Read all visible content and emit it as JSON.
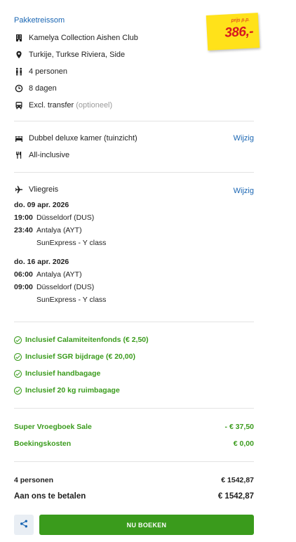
{
  "header": {
    "title": "Pakketreissom"
  },
  "price": {
    "per_person_label": "prijs p.p.",
    "amount": "386,-"
  },
  "package": {
    "hotel": "Kamelya Collection Aishen Club",
    "location": "Turkije, Turkse Riviera, Side",
    "persons": "4 personen",
    "duration": "8 dagen",
    "transfer": "Excl. transfer",
    "transfer_note": "(optioneel)"
  },
  "room": {
    "type": "Dubbel deluxe kamer (tuinzicht)",
    "board": "All-inclusive",
    "edit_label": "Wijzig"
  },
  "flight": {
    "title": "Vliegreis",
    "edit_label": "Wijzig",
    "legs": [
      {
        "date": "do. 09 apr. 2026",
        "dep_time": "19:00",
        "dep_airport": "Düsseldorf (DUS)",
        "arr_time": "23:40",
        "arr_airport": "Antalya (AYT)",
        "carrier": "SunExpress - Y class"
      },
      {
        "date": "do. 16 apr. 2026",
        "dep_time": "06:00",
        "dep_airport": "Antalya (AYT)",
        "arr_time": "09:00",
        "arr_airport": "Düsseldorf (DUS)",
        "carrier": "SunExpress - Y class"
      }
    ]
  },
  "inclusions": [
    "Inclusief Calamiteitenfonds (€ 2,50)",
    "Inclusief SGR bijdrage (€ 20,00)",
    "Inclusief handbagage",
    "Inclusief 20 kg ruimbagage"
  ],
  "discounts": [
    {
      "label": "Super Vroegboek Sale",
      "value": "- € 37,50"
    },
    {
      "label": "Boekingskosten",
      "value": "€ 0,00"
    }
  ],
  "totals": {
    "persons_label": "4 personen",
    "persons_value": "€ 1542,87",
    "pay_label": "Aan ons te betalen",
    "pay_value": "€ 1542,87"
  },
  "actions": {
    "book_label": "NU BOEKEN",
    "share_icon": "share-icon"
  },
  "colors": {
    "accent_blue": "#1a66b3",
    "green": "#3a9b1c",
    "price_red": "#d71920",
    "sticker_yellow": "#ffe21a"
  }
}
